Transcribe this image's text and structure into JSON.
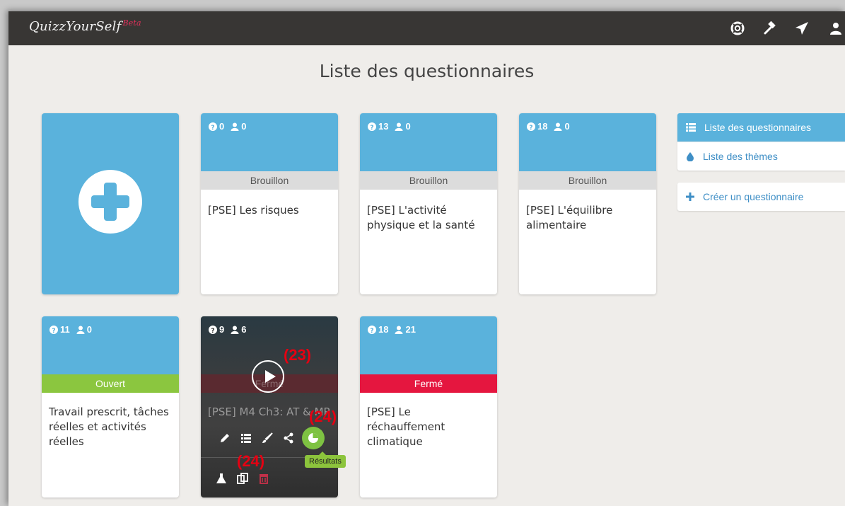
{
  "app": {
    "brand": "QuizzYourSelf",
    "beta": "Beta"
  },
  "nav_icons": [
    "lifebuoy-icon",
    "gavel-icon",
    "send-icon",
    "user-icon"
  ],
  "page": {
    "title": "Liste des questionnaires"
  },
  "cards": [
    {
      "questions": "0",
      "users": "0",
      "status": "Brouillon",
      "title": "[PSE] Les risques"
    },
    {
      "questions": "13",
      "users": "0",
      "status": "Brouillon",
      "title": "[PSE] L'activité physique et la santé"
    },
    {
      "questions": "18",
      "users": "0",
      "status": "Brouillon",
      "title": "[PSE] L'équilibre alimentaire"
    },
    {
      "questions": "11",
      "users": "0",
      "status": "Ouvert",
      "title": "Travail prescrit, tâches réelles et activités réelles"
    },
    {
      "questions": "9",
      "users": "6",
      "status": "Fermé",
      "title": "[PSE] M4 Ch3: AT & MP"
    },
    {
      "questions": "18",
      "users": "21",
      "status": "Fermé",
      "title": "[PSE] Le réchauffement climatique"
    }
  ],
  "hover_card": {
    "tooltip": "Résultats"
  },
  "annotations": {
    "a23": "(23)",
    "a24_top": "(24)",
    "a24_bottom": "(24)"
  },
  "sidebar": {
    "items": [
      {
        "label": "Liste des questionnaires"
      },
      {
        "label": "Liste des thèmes"
      }
    ],
    "create_label": "Créer un questionnaire"
  },
  "colors": {
    "primary": "#5ab2dc",
    "open": "#8bc63f",
    "closed": "#e5163f",
    "navbar": "#383634"
  }
}
